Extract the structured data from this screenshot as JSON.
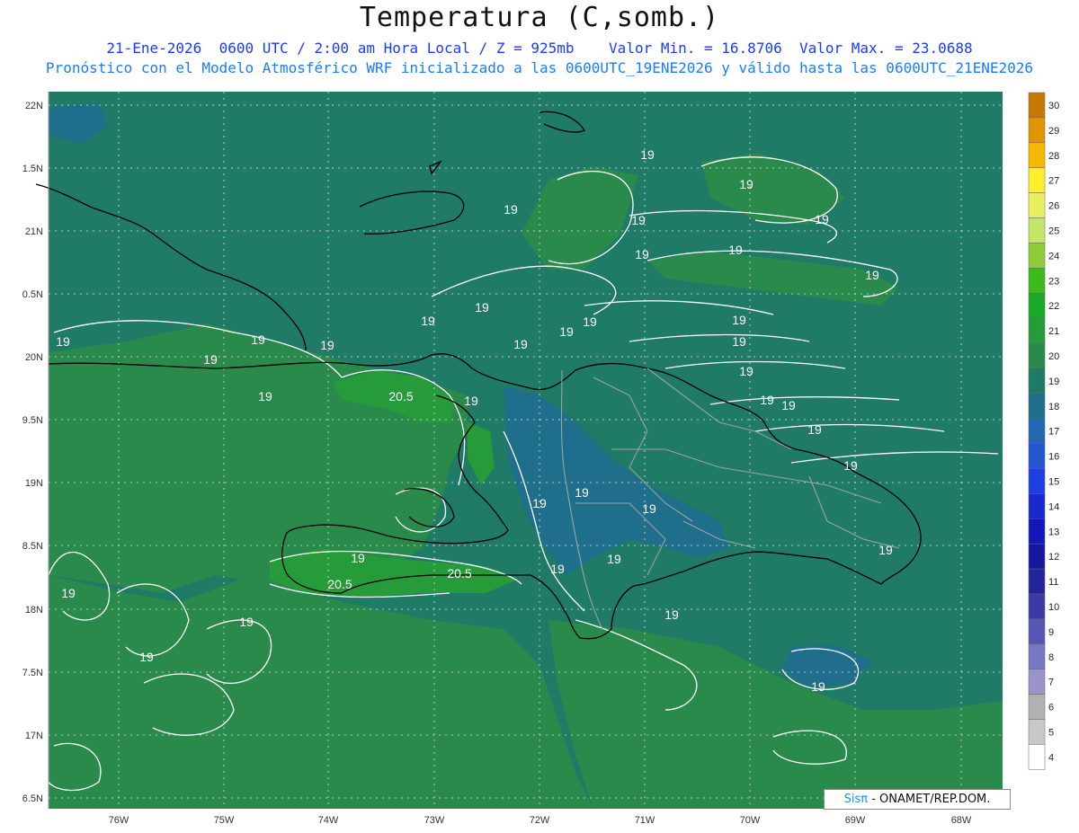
{
  "header": {
    "title": "Temperatura (C,somb.)",
    "line1_prefix": "21-Ene-2026  0600 UTC / 2:00 am Hora Local / Z = 925mb",
    "min_label": "Valor Min. =",
    "min_value": "16.8706",
    "max_label": "Valor Max. =",
    "max_value": "23.0688",
    "line2": "Pronóstico con el Modelo Atmosférico WRF inicializado a las 0600UTC_19ENE2026 y válido hasta las 0600UTC_21ENE2026"
  },
  "axes": {
    "lon_labels": [
      "76W",
      "75W",
      "74W",
      "73W",
      "72W",
      "71W",
      "70W",
      "69W",
      "68W"
    ],
    "lat_labels": [
      "22N",
      "1.5N",
      "21N",
      "0.5N",
      "20N",
      "9.5N",
      "19N",
      "8.5N",
      "18N",
      "7.5N",
      "17N",
      "6.5N"
    ]
  },
  "colorbar": {
    "labels": [
      "30",
      "29",
      "28",
      "27",
      "26",
      "25",
      "24",
      "23",
      "22",
      "21",
      "20",
      "19",
      "18",
      "17",
      "16",
      "15",
      "14",
      "13",
      "12",
      "11",
      "10",
      "9",
      "8",
      "7",
      "6",
      "5",
      "4"
    ],
    "colors": [
      "#c47a00",
      "#e09400",
      "#f7b800",
      "#ffee2a",
      "#e8f060",
      "#c6e46a",
      "#8fcc3a",
      "#3dba1c",
      "#1ba92a",
      "#259b3a",
      "#2a8a4c",
      "#1f7a66",
      "#1f6e8c",
      "#2168b0",
      "#2356cf",
      "#1f3fe0",
      "#1a29cc",
      "#1417b8",
      "#1717a0",
      "#23239b",
      "#3a3aa6",
      "#5656b4",
      "#7777c2",
      "#9a94c9",
      "#b1b1b1",
      "#c8c8c8",
      "#ffffff"
    ]
  },
  "contours": {
    "labels": [
      "19",
      "19",
      "19",
      "19",
      "19",
      "19",
      "19",
      "19",
      "19",
      "19",
      "19",
      "19",
      "19",
      "19",
      "19",
      "19",
      "19",
      "19",
      "19",
      "19",
      "19",
      "19",
      "19",
      "19",
      "19",
      "19",
      "19",
      "19",
      "19",
      "19",
      "19",
      "19",
      "19",
      "19",
      "20.5",
      "20.5",
      "20.5",
      "19",
      "19",
      "19",
      "19"
    ]
  },
  "brand": {
    "name": "Sisπ",
    "suffix": " - ONAMET/REP.DOM."
  }
}
